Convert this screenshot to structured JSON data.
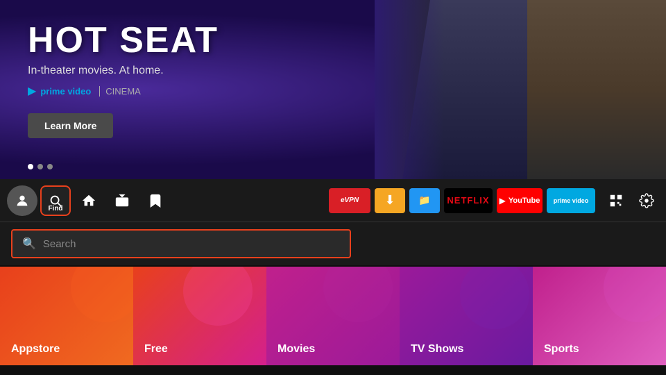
{
  "hero": {
    "title": "HOT SEAT",
    "subtitle": "In-theater movies. At home.",
    "brand_prime": "prime video",
    "brand_separator": "|",
    "brand_cinema": "CINEMA",
    "button_label": "Learn More",
    "dots": [
      {
        "active": true
      },
      {
        "active": false
      },
      {
        "active": false
      }
    ]
  },
  "navbar": {
    "find_label": "Find",
    "apps": [
      {
        "id": "expressvpn",
        "label": "ExpressVPN"
      },
      {
        "id": "downloader",
        "label": "Downloader"
      },
      {
        "id": "filemanager",
        "label": "File Manager"
      },
      {
        "id": "netflix",
        "label": "NETFLIX"
      },
      {
        "id": "youtube",
        "label": "YouTube"
      },
      {
        "id": "prime",
        "label": "prime video"
      }
    ]
  },
  "search": {
    "placeholder": "Search"
  },
  "categories": [
    {
      "id": "appstore",
      "label": "Appstore",
      "class": "cat-appstore"
    },
    {
      "id": "free",
      "label": "Free",
      "class": "cat-free"
    },
    {
      "id": "movies",
      "label": "Movies",
      "class": "cat-movies"
    },
    {
      "id": "tvshows",
      "label": "TV Shows",
      "class": "cat-tvshows"
    },
    {
      "id": "sports",
      "label": "Sports",
      "class": "cat-sports"
    }
  ]
}
